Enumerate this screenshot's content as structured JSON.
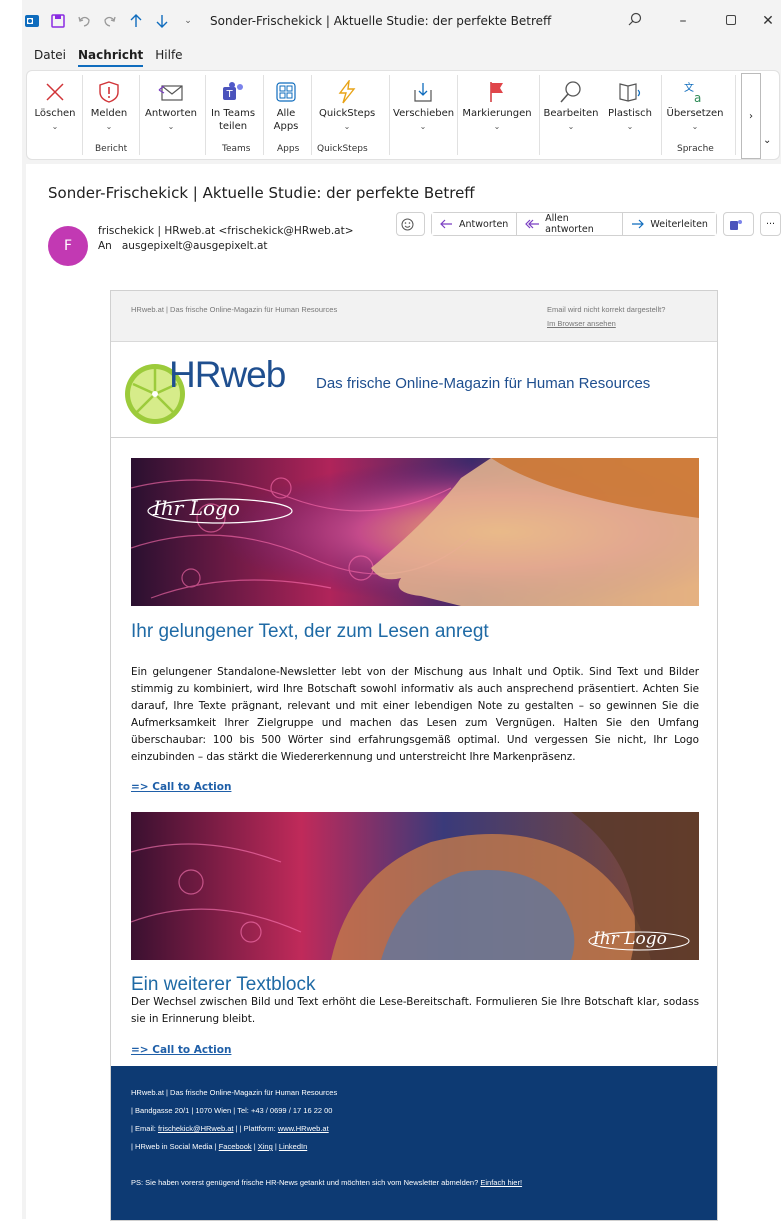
{
  "window": {
    "title": "Sonder-Frischekick | Aktuelle Studie: der perfekte Betreff"
  },
  "menu": {
    "items": [
      "Datei",
      "Nachricht",
      "Hilfe"
    ],
    "active": "Nachricht"
  },
  "ribbon": {
    "buttons": [
      {
        "label": "Löschen",
        "icon": "delete-x-icon"
      },
      {
        "label": "Melden",
        "icon": "report-shield-icon"
      },
      {
        "label": "Antworten",
        "icon": "reply-envelope-icon"
      },
      {
        "label": "In Teams teilen",
        "icon": "teams-icon"
      },
      {
        "label": "Alle Apps",
        "icon": "apps-grid-icon"
      },
      {
        "label": "QuickSteps",
        "icon": "lightning-icon"
      },
      {
        "label": "Verschieben",
        "icon": "move-icon"
      },
      {
        "label": "Markierungen",
        "icon": "flag-icon"
      },
      {
        "label": "Bearbeiten",
        "icon": "search-icon"
      },
      {
        "label": "Plastisch",
        "icon": "immersive-reader-icon"
      },
      {
        "label": "Übersetzen",
        "icon": "translate-icon"
      }
    ],
    "groups": [
      "Bericht",
      "Teams",
      "Apps",
      "QuickSteps",
      "Sprache"
    ]
  },
  "message": {
    "subject": "Sonder-Frischekick | Aktuelle Studie: der perfekte Betreff",
    "avatar_letter": "F",
    "from": "frischekick  |  HRweb.at  <frischekick@HRweb.at>",
    "to_label": "An",
    "to": "ausgepixelt@ausgepixelt.at",
    "actions": [
      "Antworten",
      "Allen antworten",
      "Weiterleiten"
    ]
  },
  "newsletter": {
    "preheader_left": "HRweb.at | Das frische Online-Magazin für Human Resources",
    "preheader_right": "Email wird nicht korrekt dargestellt?",
    "preheader_link": "Im Browser ansehen",
    "brand": "HRweb",
    "tagline": "Das frische Online-Magazin für Human Resources",
    "logo_text": "Ihr Logo",
    "heading1": "Ihr gelungener Text, der zum Lesen anregt",
    "body1": "Ein gelungener Standalone-Newsletter lebt von der Mischung aus Inhalt und Optik. Sind Text und Bilder stimmig zu kombiniert, wird Ihre Botschaft sowohl informativ als auch ansprechend präsentiert. Achten Sie darauf, Ihre Texte prägnant, relevant und mit einer lebendigen Note zu gestalten – so gewinnen Sie die Aufmerksamkeit Ihrer Zielgruppe und machen das Lesen zum Vergnügen. Halten Sie den Umfang überschaubar: 100 bis 500 Wörter sind erfahrungsgemäß optimal. Und vergessen Sie nicht, Ihr Logo einzubinden – das stärkt die Wiedererkennung und unterstreicht Ihre Markenpräsenz.",
    "cta": "=> Call to  Action",
    "heading2": "Ein weiterer Textblock",
    "body2": "Der Wechsel zwischen Bild und Text erhöht die Lese-Bereitschaft. Formulieren Sie Ihre Botschaft klar, sodass sie in Erinnerung bleibt.",
    "footer": {
      "line1": "HRweb.at | Das frische Online-Magazin für Human Resources",
      "line2": "| Bandgasse 20/1 | 1070 Wien | Tel: +43 / 0699 / 17 16 22 00",
      "email_label": "| Email: ",
      "email": "frischekick@HRweb.at",
      "platform_label": " | | Plattform: ",
      "platform": "www.HRweb.at",
      "social_label": "| HRweb in Social Media | ",
      "social1": "Facebook",
      "social2": "Xing",
      "social3": "LinkedIn",
      "sep": " | ",
      "ps": "PS: Sie haben vorerst genügend frische HR-News getankt und möchten sich vom Newsletter abmelden? ",
      "unsubscribe": "Einfach hier!"
    }
  },
  "colors": {
    "accent": "#0f6cbd",
    "avatar": "#c239b3",
    "footer_bg": "#0d3a73",
    "heading": "#1f6aa5"
  }
}
